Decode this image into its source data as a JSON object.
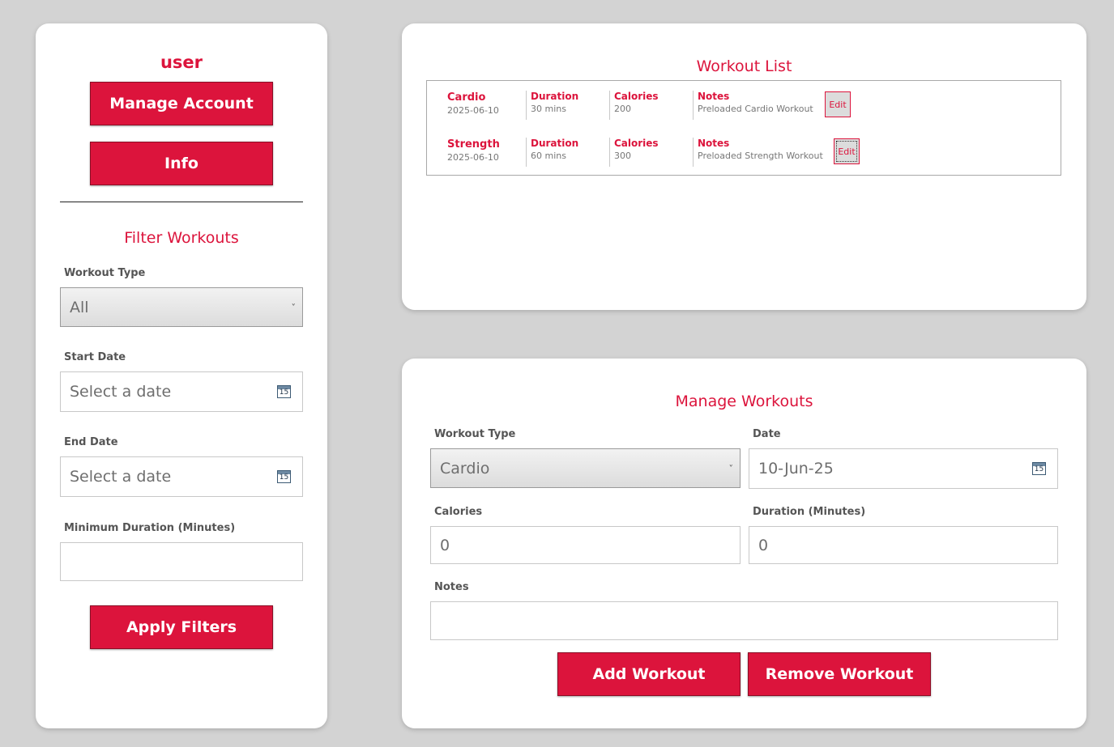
{
  "sidebar": {
    "username": "user",
    "manage_account_label": "Manage Account",
    "info_label": "Info",
    "filter_title": "Filter Workouts",
    "workout_type_label": "Workout Type",
    "workout_type_value": "All",
    "start_date_label": "Start Date",
    "start_date_placeholder": "Select a date",
    "end_date_label": "End Date",
    "end_date_placeholder": "Select a date",
    "min_duration_label": "Minimum Duration (Minutes)",
    "min_duration_value": "",
    "apply_filters_label": "Apply Filters"
  },
  "workout_list": {
    "title": "Workout List",
    "rows": [
      {
        "type": "Cardio",
        "date": "2025-06-10",
        "duration_label": "Duration",
        "duration": "30 mins",
        "calories_label": "Calories",
        "calories": "200",
        "notes_label": "Notes",
        "notes": "Preloaded Cardio Workout",
        "edit_label": "Edit"
      },
      {
        "type": "Strength",
        "date": "2025-06-10",
        "duration_label": "Duration",
        "duration": "60 mins",
        "calories_label": "Calories",
        "calories": "300",
        "notes_label": "Notes",
        "notes": "Preloaded Strength Workout",
        "edit_label": "Edit"
      }
    ]
  },
  "manage": {
    "title": "Manage Workouts",
    "workout_type_label": "Workout Type",
    "workout_type_value": "Cardio",
    "date_label": "Date",
    "date_value": "10-Jun-25",
    "calories_label": "Calories",
    "calories_value": "0",
    "duration_label": "Duration (Minutes)",
    "duration_value": "0",
    "notes_label": "Notes",
    "notes_value": "",
    "add_label": "Add Workout",
    "remove_label": "Remove Workout"
  },
  "icons": {
    "calendar_day": "15",
    "chevron": "˅"
  },
  "colors": {
    "accent": "#dc143c",
    "background": "#d3d3d3"
  }
}
